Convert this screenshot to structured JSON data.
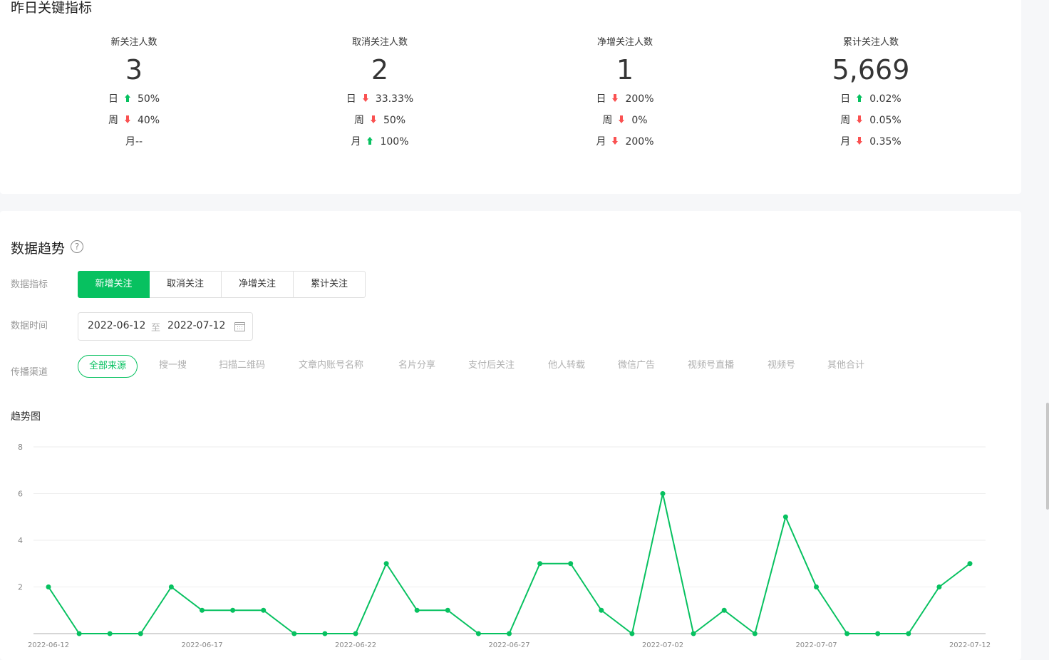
{
  "kpi_section": {
    "title": "昨日关键指标",
    "cards": [
      {
        "label": "新关注人数",
        "value": "3",
        "day": {
          "period": "日",
          "dir": "up",
          "pct": "50%"
        },
        "week": {
          "period": "周",
          "dir": "down",
          "pct": "40%"
        },
        "month": {
          "period": "月",
          "dir": "none",
          "pct": "--"
        }
      },
      {
        "label": "取消关注人数",
        "value": "2",
        "day": {
          "period": "日",
          "dir": "down",
          "pct": "33.33%"
        },
        "week": {
          "period": "周",
          "dir": "down",
          "pct": "50%"
        },
        "month": {
          "period": "月",
          "dir": "up",
          "pct": "100%"
        }
      },
      {
        "label": "净增关注人数",
        "value": "1",
        "day": {
          "period": "日",
          "dir": "down",
          "pct": "200%"
        },
        "week": {
          "period": "周",
          "dir": "down",
          "pct": "0%"
        },
        "month": {
          "period": "月",
          "dir": "down",
          "pct": "200%"
        }
      },
      {
        "label": "累计关注人数",
        "value": "5,669",
        "day": {
          "period": "日",
          "dir": "up",
          "pct": "0.02%"
        },
        "week": {
          "period": "周",
          "dir": "down",
          "pct": "0.05%"
        },
        "month": {
          "period": "月",
          "dir": "down",
          "pct": "0.35%"
        }
      }
    ]
  },
  "trend_section": {
    "title": "数据趋势",
    "help_icon": "?",
    "metric_label": "数据指标",
    "metric_tabs": [
      "新增关注",
      "取消关注",
      "净增关注",
      "累计关注"
    ],
    "active_tab": 0,
    "time_label": "数据时间",
    "date_start": "2022-06-12",
    "date_sep": "至",
    "date_end": "2022-07-12",
    "channel_label": "传播渠道",
    "channels": [
      "全部来源",
      "搜一搜",
      "扫描二维码",
      "文章内账号名称",
      "名片分享",
      "支付后关注",
      "他人转载",
      "微信广告",
      "视频号直播",
      "视频号",
      "其他合计"
    ],
    "active_channel": 0,
    "chart_title": "趋势图"
  },
  "colors": {
    "accent": "#07c160",
    "up": "#07c160",
    "down": "#fa5151"
  },
  "chart_data": {
    "type": "line",
    "x": [
      "2022-06-12",
      "2022-06-13",
      "2022-06-14",
      "2022-06-15",
      "2022-06-16",
      "2022-06-17",
      "2022-06-18",
      "2022-06-19",
      "2022-06-20",
      "2022-06-21",
      "2022-06-22",
      "2022-06-23",
      "2022-06-24",
      "2022-06-25",
      "2022-06-26",
      "2022-06-27",
      "2022-06-28",
      "2022-06-29",
      "2022-06-30",
      "2022-07-01",
      "2022-07-02",
      "2022-07-03",
      "2022-07-04",
      "2022-07-05",
      "2022-07-06",
      "2022-07-07",
      "2022-07-08",
      "2022-07-09",
      "2022-07-10",
      "2022-07-11",
      "2022-07-12"
    ],
    "values": [
      2,
      0,
      0,
      0,
      2,
      1,
      1,
      1,
      0,
      0,
      0,
      3,
      1,
      1,
      0,
      0,
      3,
      3,
      1,
      0,
      6,
      0,
      1,
      0,
      5,
      2,
      0,
      0,
      0,
      2,
      3
    ],
    "x_tick_labels": [
      "2022-06-12",
      "2022-06-17",
      "2022-06-22",
      "2022-06-27",
      "2022-07-02",
      "2022-07-07",
      "2022-07-12"
    ],
    "y_ticks": [
      "2",
      "4",
      "6",
      "8"
    ],
    "ylim": [
      0,
      8
    ],
    "grid": true,
    "color": "#07c160"
  }
}
